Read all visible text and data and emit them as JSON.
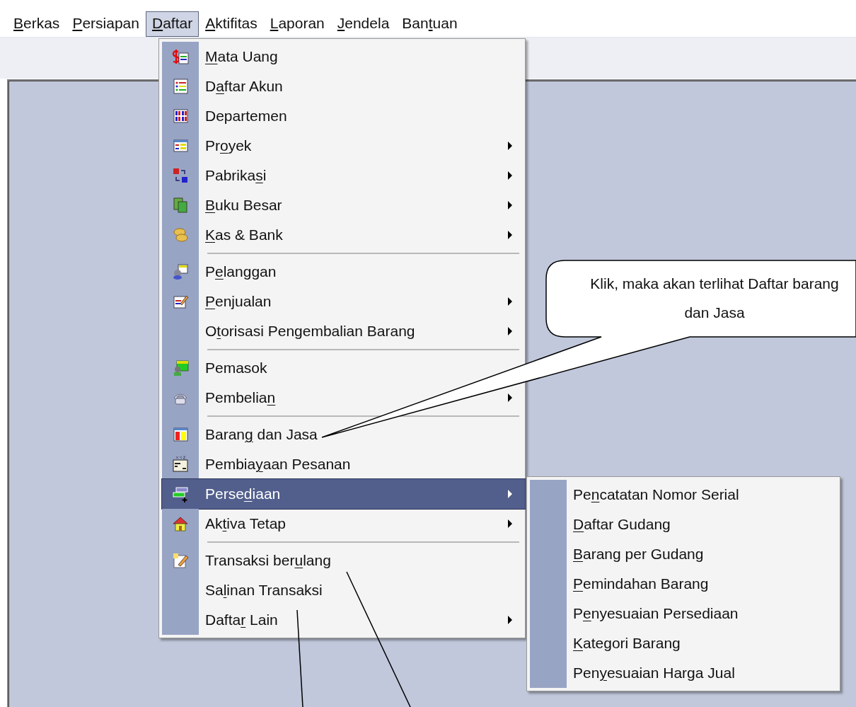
{
  "menubar": [
    {
      "key": "B",
      "post": "erkas",
      "selected": false
    },
    {
      "key": "P",
      "post": "ersiapan",
      "selected": false
    },
    {
      "key": "D",
      "post": "aftar",
      "selected": true
    },
    {
      "key": "A",
      "post": "ktifitas",
      "selected": false
    },
    {
      "key": "L",
      "post": "aporan",
      "selected": false
    },
    {
      "key": "J",
      "post": "endela",
      "selected": false
    },
    {
      "pre": "Ban",
      "key": "t",
      "post": "uan",
      "selected": false
    }
  ],
  "menu": [
    {
      "kind": "item",
      "key": "M",
      "post": "ata Uang",
      "submenu": false,
      "selected": false
    },
    {
      "kind": "item",
      "pre": "D",
      "key": "a",
      "post": "ftar Akun",
      "submenu": false,
      "selected": false
    },
    {
      "kind": "item",
      "pre": "Departemen",
      "submenu": false,
      "selected": false
    },
    {
      "kind": "item",
      "pre": "Pr",
      "key": "o",
      "post": "yek",
      "submenu": true,
      "selected": false
    },
    {
      "kind": "item",
      "pre": "Pabrika",
      "key": "s",
      "post": "i",
      "submenu": true,
      "selected": false
    },
    {
      "kind": "item",
      "key": "B",
      "post": "uku Besar",
      "submenu": true,
      "selected": false
    },
    {
      "kind": "item",
      "key": "K",
      "post": "as & Bank",
      "submenu": true,
      "selected": false
    },
    {
      "kind": "separator"
    },
    {
      "kind": "item",
      "pre": "P",
      "key": "e",
      "post": "langgan",
      "submenu": false,
      "selected": false
    },
    {
      "kind": "item",
      "key": "P",
      "post": "enjualan",
      "submenu": true,
      "selected": false
    },
    {
      "kind": "item",
      "pre": "O",
      "key": "t",
      "post": "orisasi Pengembalian Barang",
      "submenu": true,
      "selected": false
    },
    {
      "kind": "separator"
    },
    {
      "kind": "item",
      "pre": "Pemasok",
      "submenu": false,
      "selected": false
    },
    {
      "kind": "item",
      "pre": "Pembelia",
      "key": "n",
      "submenu": true,
      "selected": false
    },
    {
      "kind": "separator"
    },
    {
      "kind": "item",
      "pre": "Baran",
      "key": "g",
      "post": " dan Jasa",
      "submenu": false,
      "selected": false
    },
    {
      "kind": "item",
      "pre": "Pembia",
      "key": "y",
      "post": "aan Pesanan",
      "submenu": false,
      "selected": false
    },
    {
      "kind": "item",
      "pre": "Perse",
      "key": "d",
      "post": "iaan",
      "submenu": true,
      "selected": true
    },
    {
      "kind": "item",
      "pre": "Ak",
      "key": "t",
      "post": "iva Tetap",
      "submenu": true,
      "selected": false
    },
    {
      "kind": "separator"
    },
    {
      "kind": "item",
      "pre": "Transaksi ber",
      "key": "u",
      "post": "lang",
      "submenu": false,
      "selected": false
    },
    {
      "kind": "item",
      "pre": "Sa",
      "key": "l",
      "post": "inan Transaksi",
      "submenu": false,
      "selected": false
    },
    {
      "kind": "item",
      "pre": "Dafta",
      "key": "r",
      "post": " Lain",
      "submenu": true,
      "selected": false
    }
  ],
  "submenu": [
    {
      "pre": "Pe",
      "key": "n",
      "post": "catatan Nomor Serial"
    },
    {
      "key": "D",
      "post": "aftar Gudang"
    },
    {
      "key": "B",
      "post": "arang per Gudang"
    },
    {
      "key": "P",
      "post": "emindahan Barang"
    },
    {
      "pre": "P",
      "key": "e",
      "post": "nyesuaian Persediaan"
    },
    {
      "key": "K",
      "post": "ategori Barang"
    },
    {
      "pre": "Pen",
      "key": "y",
      "post": "esuaian Harga Jual"
    }
  ],
  "callout": {
    "text": "Klik, maka akan terlihat Daftar barang dan Jasa"
  }
}
